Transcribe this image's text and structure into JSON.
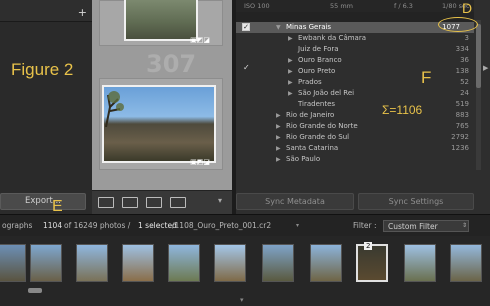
{
  "left_panel": {
    "figure_label": "Figure 2",
    "export_button": "Export...",
    "add_icon": "plus-icon"
  },
  "grid": {
    "watermark_number": "307"
  },
  "info_bar": {
    "iso": "ISO 100",
    "focal": "55 mm",
    "aperture": "f / 6.3",
    "shutter": "1/80 sec"
  },
  "keyword_tree": {
    "rows": [
      {
        "label": "Minas Gerais",
        "count": "1077",
        "level": 0,
        "selected": true
      },
      {
        "label": "Ewbank da Câmara",
        "count": "3",
        "level": 1
      },
      {
        "label": "Juiz de Fora",
        "count": "334",
        "level": 2
      },
      {
        "label": "Ouro Branco",
        "count": "36",
        "level": 1
      },
      {
        "label": "Ouro Preto",
        "count": "138",
        "level": 1
      },
      {
        "label": "Prados",
        "count": "52",
        "level": 1
      },
      {
        "label": "São João del Rei",
        "count": "24",
        "level": 1
      },
      {
        "label": "Tiradentes",
        "count": "519",
        "level": 2
      },
      {
        "label": "Rio de Janeiro",
        "count": "883",
        "level": 0
      },
      {
        "label": "Rio Grande do Norte",
        "count": "765",
        "level": 0
      },
      {
        "label": "Rio Grande do Sul",
        "count": "2792",
        "level": 0
      },
      {
        "label": "Santa Catarina",
        "count": "1236",
        "level": 0
      },
      {
        "label": "São Paulo",
        "count": "",
        "level": 0
      }
    ]
  },
  "annotations": {
    "d": "D",
    "e": "E",
    "f": "F",
    "sum": "Σ=1106"
  },
  "right_panel": {
    "sync_metadata": "Sync Metadata",
    "sync_settings": "Sync Settings"
  },
  "status_bar": {
    "prefix": "ographs",
    "count": "1104",
    "rest": "of 16249 photos /",
    "selected": "1 selected",
    "file": "/1108_Ouro_Preto_001.cr2",
    "filter_label": "Filter :",
    "filter_value": "Custom Filter"
  },
  "filmstrip": {
    "badge": "2"
  },
  "colors": {
    "accent": "#e8c24a",
    "selection": "#5a5a5a"
  }
}
